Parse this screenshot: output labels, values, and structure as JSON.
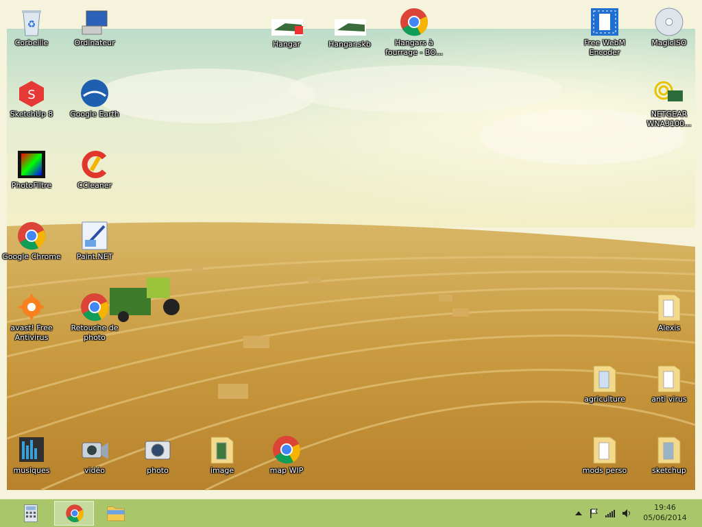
{
  "desktop": {
    "icons": [
      {
        "name": "recycle-bin-icon",
        "label": "Corbeille"
      },
      {
        "name": "computer-icon",
        "label": "Ordinateur"
      },
      {
        "name": "sketchup-file-icon",
        "label": "Hangar"
      },
      {
        "name": "sketchup-backup-icon",
        "label": "Hangar.skb"
      },
      {
        "name": "chrome-icon",
        "label": "Hangars à fourrage - BO..."
      },
      {
        "name": "video-encoder-icon",
        "label": "Free WebM Encoder"
      },
      {
        "name": "disc-icon",
        "label": "MagicISO"
      },
      {
        "name": "sketchup-icon",
        "label": "SketchUp 8"
      },
      {
        "name": "google-earth-icon",
        "label": "Google Earth"
      },
      {
        "name": "wireless-adapter-icon",
        "label": "NETGEAR WNA3100..."
      },
      {
        "name": "photofiltre-icon",
        "label": "PhotoFiltre"
      },
      {
        "name": "ccleaner-icon",
        "label": "CCleaner"
      },
      {
        "name": "chrome-icon",
        "label": "Google Chrome"
      },
      {
        "name": "paint-net-icon",
        "label": "Paint.NET"
      },
      {
        "name": "avast-icon",
        "label": "avast! Free Antivirus"
      },
      {
        "name": "chrome-icon",
        "label": "Retouche de photo"
      },
      {
        "name": "folder-icon",
        "label": "Alexis"
      },
      {
        "name": "folder-icon",
        "label": "agriculture"
      },
      {
        "name": "folder-icon",
        "label": "anti virus"
      },
      {
        "name": "music-library-icon",
        "label": "musiques"
      },
      {
        "name": "video-camera-icon",
        "label": "vidéo"
      },
      {
        "name": "camera-icon",
        "label": "photo"
      },
      {
        "name": "folder-icon",
        "label": "image"
      },
      {
        "name": "chrome-icon",
        "label": "map WIP"
      },
      {
        "name": "folder-icon",
        "label": "mods perso"
      },
      {
        "name": "folder-icon",
        "label": "sketchup"
      }
    ]
  },
  "taskbar": {
    "pinned": [
      {
        "name": "calculator-icon"
      },
      {
        "name": "chrome-icon"
      },
      {
        "name": "file-explorer-icon"
      }
    ],
    "tray": [
      "show-hidden-icons-icon",
      "flag-icon",
      "signal-icon",
      "volume-icon"
    ],
    "time": "19:46",
    "date": "05/06/2014"
  },
  "colors": {
    "taskbar": "#a9c76a",
    "chrome_red": "#db4437",
    "chrome_green": "#0f9d58",
    "chrome_yellow": "#f4b400",
    "chrome_blue": "#4285f4",
    "folder": "#f3d98b"
  }
}
